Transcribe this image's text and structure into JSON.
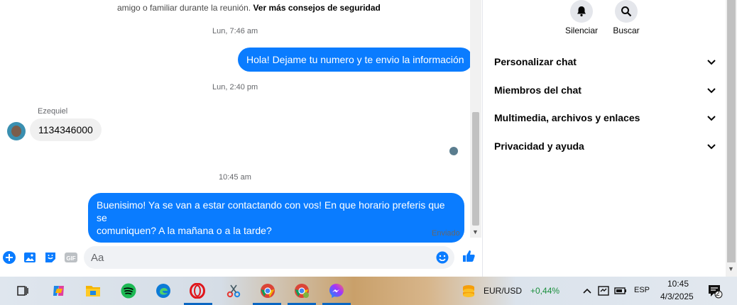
{
  "chat": {
    "system_notice": "amigo o familiar durante la reunión.",
    "system_link": "Ver más consejos de seguridad",
    "messages": [
      {
        "time": "Lun, 7:46 am",
        "text": "Hola! Dejame tu numero y te envio la información"
      },
      {
        "time": "Lun, 2:40 pm",
        "sender": "Ezequiel",
        "text": "1134346000"
      },
      {
        "time": "10:45 am",
        "text_line1": "Buenisimo! Ya se van a estar contactando con vos! En que horario preferis que se",
        "text_line2": "comuniquen? A la mañana o a la tarde?"
      }
    ],
    "status": "Enviado"
  },
  "composer": {
    "placeholder": "Aa"
  },
  "panel": {
    "mute_label": "Silenciar",
    "search_label": "Buscar",
    "sections": [
      "Personalizar chat",
      "Miembros del chat",
      "Multimedia, archivos y enlaces",
      "Privacidad y ayuda"
    ]
  },
  "taskbar": {
    "ticker_pair": "EUR/USD",
    "ticker_change": "+0,44%",
    "language": "ESP",
    "time": "10:45",
    "date": "4/3/2025",
    "notification_count": "2"
  },
  "colors": {
    "messenger_blue": "#0a7cff",
    "ticker_green": "#1a8f3c"
  }
}
